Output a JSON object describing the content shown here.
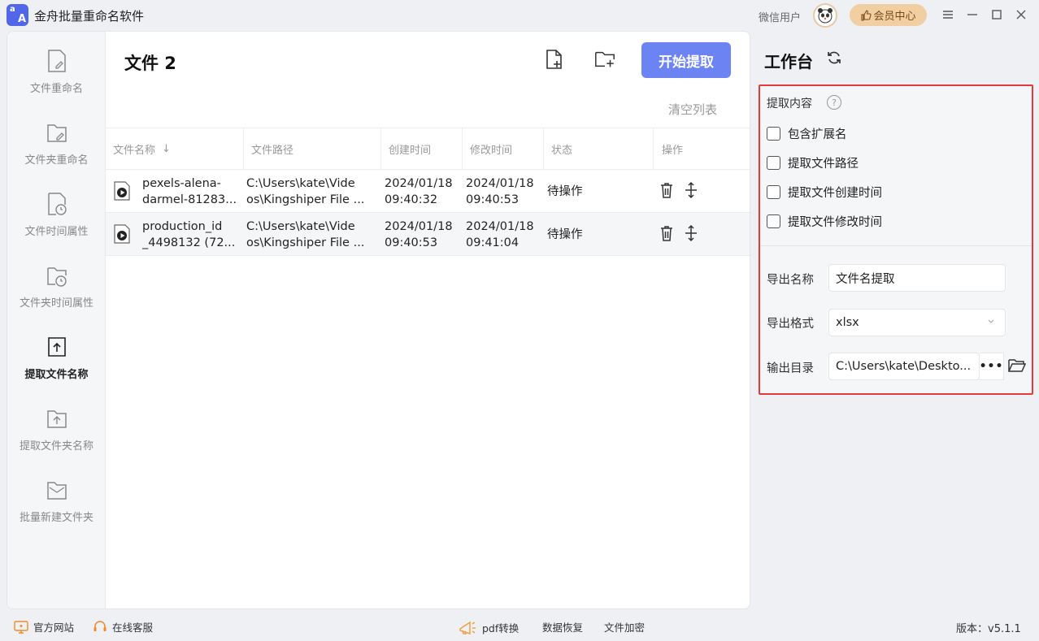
{
  "app": {
    "title": "金舟批量重命名软件",
    "logo_text_1": "a",
    "logo_text_2": "A",
    "user_name": "微信用户",
    "vip_label": "会员中心"
  },
  "sidebar": {
    "items": [
      {
        "label": "文件重命名",
        "icon": "file-edit-icon",
        "active": false
      },
      {
        "label": "文件夹重命名",
        "icon": "folder-edit-icon",
        "active": false
      },
      {
        "label": "文件时间属性",
        "icon": "file-clock-icon",
        "active": false
      },
      {
        "label": "文件夹时间属性",
        "icon": "folder-clock-icon",
        "active": false
      },
      {
        "label": "提取文件名称",
        "icon": "file-upload-icon",
        "active": true
      },
      {
        "label": "提取文件夹名称",
        "icon": "folder-upload-icon",
        "active": false
      },
      {
        "label": "批量新建文件夹",
        "icon": "folder-new-icon",
        "active": false
      }
    ]
  },
  "main": {
    "file_count_title": "文件 2",
    "start_button": "开始提取",
    "clear_list": "清空列表",
    "columns": [
      "文件名称",
      "文件路径",
      "创建时间",
      "修改时间",
      "状态",
      "操作"
    ],
    "sort_indicator": "↓",
    "rows": [
      {
        "name_line1": "pexels-alena-",
        "name_line2": "darmel-81283...",
        "path_line1": "C:\\Users\\kate\\Vide",
        "path_line2": "os\\Kingshiper File ...",
        "created_date": "2024/01/18",
        "created_time": "09:40:32",
        "modified_date": "2024/01/18",
        "modified_time": "09:40:53",
        "status": "待操作"
      },
      {
        "name_line1": "production_id",
        "name_line2": "_4498132 (72...",
        "path_line1": "C:\\Users\\kate\\Vide",
        "path_line2": "os\\Kingshiper File ...",
        "created_date": "2024/01/18",
        "created_time": "09:40:53",
        "modified_date": "2024/01/18",
        "modified_time": "09:41:04",
        "status": "待操作"
      }
    ]
  },
  "panel": {
    "title": "工作台",
    "section_title": "提取内容",
    "help": "?",
    "options": [
      {
        "label": "包含扩展名",
        "checked": false
      },
      {
        "label": "提取文件路径",
        "checked": false
      },
      {
        "label": "提取文件创建时间",
        "checked": false
      },
      {
        "label": "提取文件修改时间",
        "checked": false
      }
    ],
    "export_name_label": "导出名称",
    "export_name_value": "文件名提取",
    "export_format_label": "导出格式",
    "export_format_value": "xlsx",
    "output_dir_label": "输出目录",
    "output_dir_value": "C:\\Users\\kate\\Deskto...",
    "dots": "•••",
    "highlight_color": "#e33b3b"
  },
  "footer": {
    "official_site": "官方网站",
    "online_service": "在线客服",
    "pdf_convert": "pdf转换",
    "data_recovery": "数据恢复",
    "file_encrypt": "文件加密",
    "version": "版本：v5.1.1"
  }
}
